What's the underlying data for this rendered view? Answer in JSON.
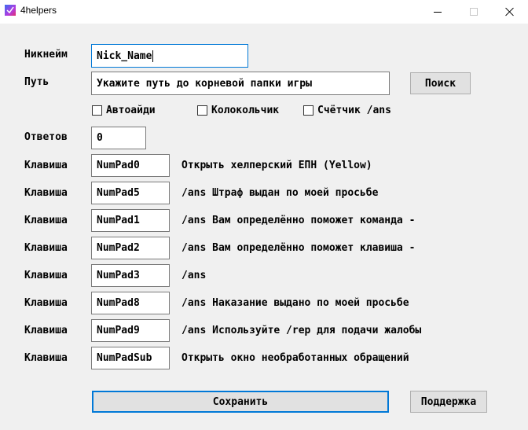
{
  "window": {
    "title": "4helpers"
  },
  "form": {
    "nickname_label": "Никнейм",
    "nickname_value": "Nick_Name",
    "path_label": "Путь",
    "path_value": "Укажите путь до корневой папки игры",
    "search_label": "Поиск",
    "checkboxes": [
      {
        "label": "Автоайди",
        "checked": false
      },
      {
        "label": "Колокольчик",
        "checked": false
      },
      {
        "label": "Счётчик /ans",
        "checked": false
      }
    ],
    "answers_label": "Ответов",
    "answers_value": "0"
  },
  "keybinds": [
    {
      "label": "Клавиша",
      "key": "NumPad0",
      "text": "Открыть хелперский ЕПН (Yellow)"
    },
    {
      "label": "Клавиша",
      "key": "NumPad5",
      "text": "/ans Штраф выдан по моей просьбе"
    },
    {
      "label": "Клавиша",
      "key": "NumPad1",
      "text": "/ans Вам определённо поможет команда -"
    },
    {
      "label": "Клавиша",
      "key": "NumPad2",
      "text": "/ans Вам определённо поможет клавиша -"
    },
    {
      "label": "Клавиша",
      "key": "NumPad3",
      "text": "/ans"
    },
    {
      "label": "Клавиша",
      "key": "NumPad8",
      "text": "/ans Наказание выдано по моей просьбе"
    },
    {
      "label": "Клавиша",
      "key": "NumPad9",
      "text": "/ans Используйте /rep для подачи жалобы"
    },
    {
      "label": "Клавиша",
      "key": "NumPadSub",
      "text": "Открыть окно необработанных обращений"
    }
  ],
  "footer": {
    "save_label": "Сохранить",
    "support_label": "Поддержка"
  },
  "colors": {
    "focus_border": "#0078d7",
    "window_bg": "#f0f0f0"
  }
}
